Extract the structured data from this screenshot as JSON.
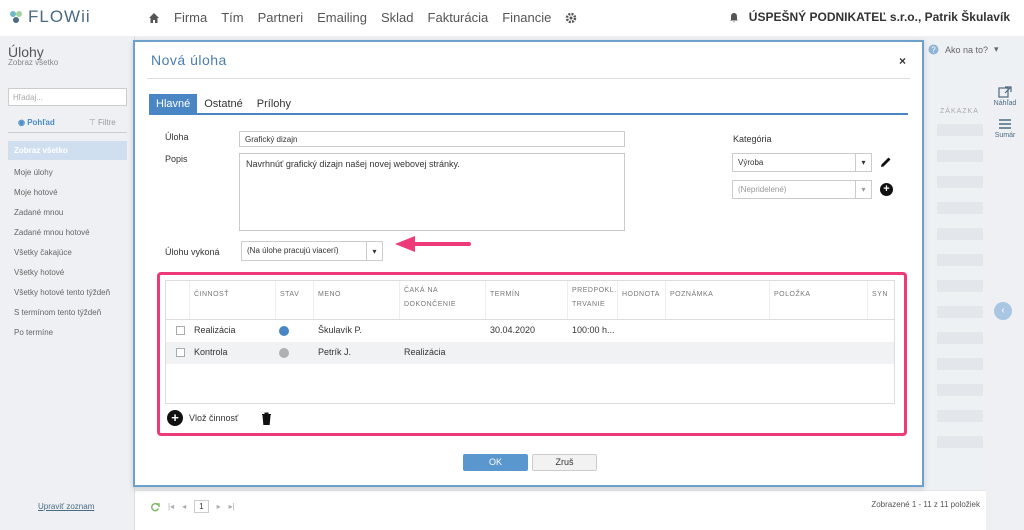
{
  "app": {
    "logo_text": "FLOWii"
  },
  "nav": {
    "items": [
      "Firma",
      "Tím",
      "Partneri",
      "Emailing",
      "Sklad",
      "Fakturácia",
      "Financie"
    ],
    "user": "ÚSPEŠNÝ PODNIKATEĽ s.r.o., Patrik Škulavík"
  },
  "sidebar": {
    "title": "Úlohy",
    "subtitle": "Zobraz všetko",
    "search_placeholder": "Hľadaj...",
    "tab_view": "Pohľad",
    "tab_filter": "Filtre",
    "active_item": "Zobraz všetko",
    "items": [
      "Moje úlohy",
      "Moje hotové",
      "Zadané mnou",
      "Zadané mnou hotové",
      "Všetky čakajúce",
      "Všetky hotové",
      "Všetky hotové tento týždeň",
      "S termínom tento týždeň",
      "Po termíne"
    ],
    "footer_link": "Upraviť zoznam"
  },
  "header": {
    "help": "Ako na to?"
  },
  "rightbar": {
    "preview": "Náhľad",
    "summary": "Sumár"
  },
  "list": {
    "column": "ZÁKAZKA"
  },
  "pager": {
    "page": "1",
    "count": "Zobrazené 1 - 11 z 11 položiek"
  },
  "modal": {
    "title": "Nová úloha",
    "close": "×",
    "tabs": [
      "Hlavné",
      "Ostatné",
      "Prílohy"
    ],
    "task_label": "Úloha",
    "task_value": "Grafický dizajn",
    "desc_label": "Popis",
    "desc_value": "Navrhnúť grafický dizajn našej novej webovej stránky.",
    "category_label": "Kategória",
    "category_value": "Výroba",
    "category2_value": "(Nepridelené)",
    "assignee_label": "Úlohu vykoná",
    "assignee_value": "(Na úlohe pracujú viacerí)",
    "grid": {
      "headers": [
        "ČINNOSŤ",
        "STAV",
        "MENO",
        "ČAKÁ NA DOKONČENIE",
        "TERMÍN",
        "PREDPOKL. TRVANIE",
        "HODNOTA",
        "POZNÁMKA",
        "POLOŽKA",
        "SYN"
      ],
      "rows": [
        {
          "activity": "Realizácia",
          "name": "Škulavík P.",
          "waits_for": "",
          "deadline": "30.04.2020",
          "duration": "100:00 h..."
        },
        {
          "activity": "Kontrola",
          "name": "Petrík J.",
          "waits_for": "Realizácia",
          "deadline": "",
          "duration": ""
        }
      ],
      "status_colors": [
        "#4a86c4",
        "#b0b0b0"
      ]
    },
    "add_activity": "Vlož činnosť",
    "ok": "OK",
    "cancel": "Zruš"
  },
  "colors": {
    "accent": "#4a86c4",
    "highlight": "#ef3a7a"
  }
}
